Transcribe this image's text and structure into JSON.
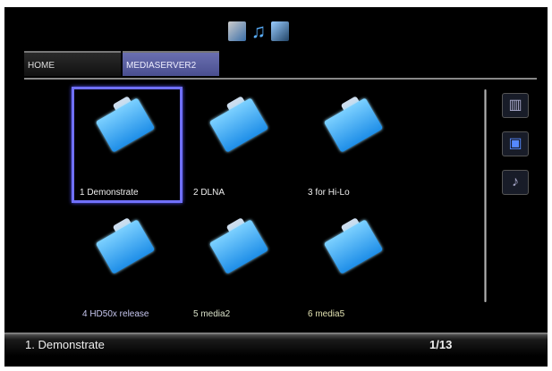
{
  "header": {
    "icons": [
      "photo-icon",
      "music-icon",
      "video-icon"
    ]
  },
  "tabs": [
    {
      "label": "HOME"
    },
    {
      "label": "MEDIASERVER2"
    }
  ],
  "items": [
    {
      "label": "1 Demonstrate",
      "color": "#eeeeee"
    },
    {
      "label": "2 DLNA",
      "color": "#eeeeee"
    },
    {
      "label": "3 for Hi-Lo",
      "color": "#eeeeee"
    },
    {
      "label": "4 HD50x release",
      "color": "#c8c8f0"
    },
    {
      "label": "5 media2",
      "color": "#d8e0c8"
    },
    {
      "label": "6 media5",
      "color": "#e0e0b0"
    }
  ],
  "side_icons": [
    "grid-view-icon",
    "photo-view-icon",
    "music-view-icon"
  ],
  "status": {
    "selected": "1. Demonstrate",
    "page": "1/13"
  }
}
